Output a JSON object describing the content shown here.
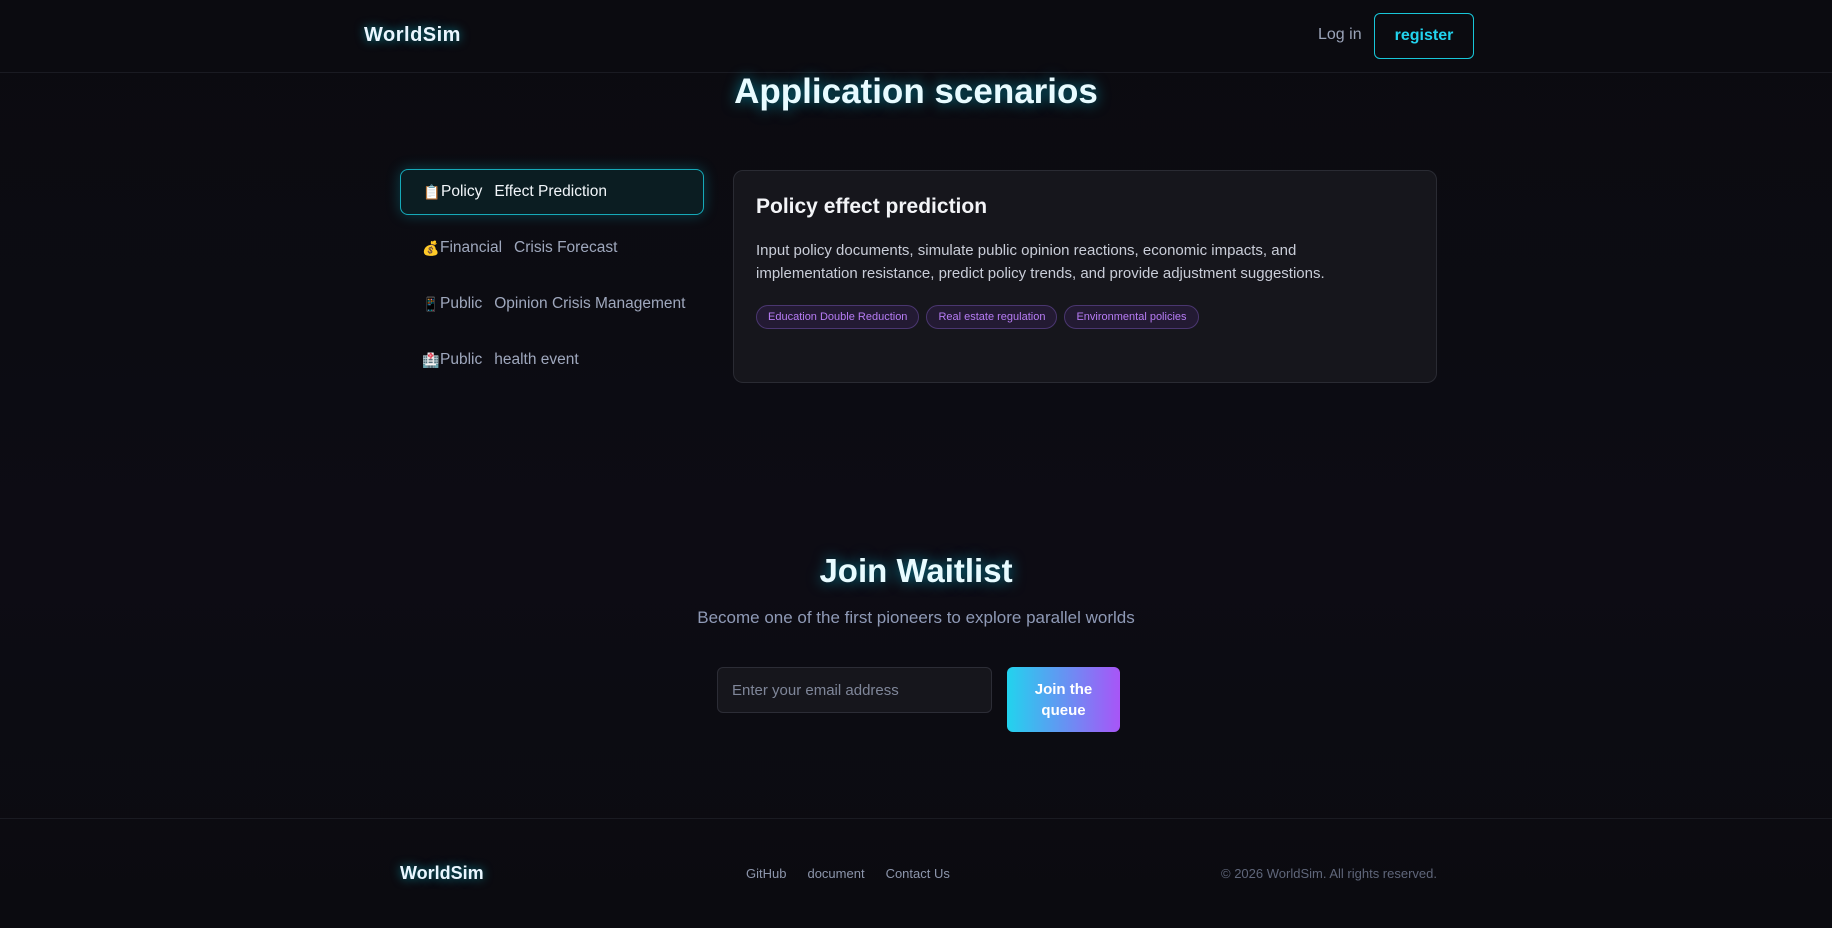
{
  "header": {
    "brand": "WorldSim",
    "login": "Log in",
    "register": "register"
  },
  "scenarios": {
    "title": "Application scenarios",
    "tabs": [
      {
        "emoji": "📋",
        "word": "Policy",
        "rest": "Effect Prediction"
      },
      {
        "emoji": "💰",
        "word": "Financial",
        "rest": "Crisis Forecast"
      },
      {
        "emoji": "📱",
        "word": "Public",
        "rest": "Opinion Crisis Management"
      },
      {
        "emoji": "🏥",
        "word": "Public",
        "rest": "health event"
      }
    ],
    "card": {
      "title": "Policy effect prediction",
      "description": "Input policy documents, simulate public opinion reactions, economic impacts, and implementation resistance, predict policy trends, and provide adjustment suggestions.",
      "tags": [
        "Education Double Reduction",
        "Real estate regulation",
        "Environmental policies"
      ]
    }
  },
  "waitlist": {
    "title": "Join Waitlist",
    "subtitle": "Become one of the first pioneers to explore parallel worlds",
    "email_placeholder": "Enter your email address",
    "button": "Join the queue"
  },
  "footer": {
    "brand": "WorldSim",
    "links": [
      "GitHub",
      "document",
      "Contact Us"
    ],
    "copyright": "© 2026 WorldSim. All rights reserved."
  },
  "colors": {
    "accent_cyan": "#22d3ee",
    "accent_purple": "#a855f7",
    "background": "#0b0b10"
  }
}
